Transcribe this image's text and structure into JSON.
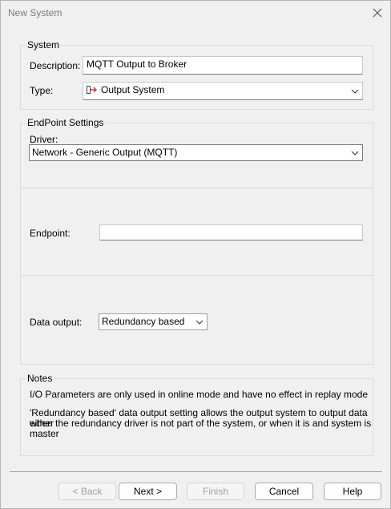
{
  "window": {
    "title": "New System"
  },
  "system_group": {
    "label": "System",
    "description_label": "Description:",
    "description_value": "MQTT Output to Broker",
    "type_label": "Type:",
    "type_value": "Output System",
    "type_icon": "output-system-icon"
  },
  "endpoint_group": {
    "label": "EndPoint Settings",
    "driver_label": "Driver:",
    "driver_value": "Network - Generic Output (MQTT)",
    "endpoint_label": "Endpoint:",
    "endpoint_value": "",
    "data_output_label": "Data output:",
    "data_output_value": "Redundancy based"
  },
  "notes_group": {
    "label": "Notes",
    "line1": "I/O Parameters are only used in online mode and have no effect in replay mode",
    "line2a": "'Redundancy based' data output setting allows the output system to output data either",
    "line2b": "when the redundancy driver is not part of the system, or when it is and system is master"
  },
  "buttons": {
    "back": "< Back",
    "next": "Next >",
    "finish": "Finish",
    "cancel": "Cancel",
    "help": "Help"
  },
  "colors": {
    "icon_accent": "#c0392b",
    "disabled_text": "#a0a0a0"
  }
}
